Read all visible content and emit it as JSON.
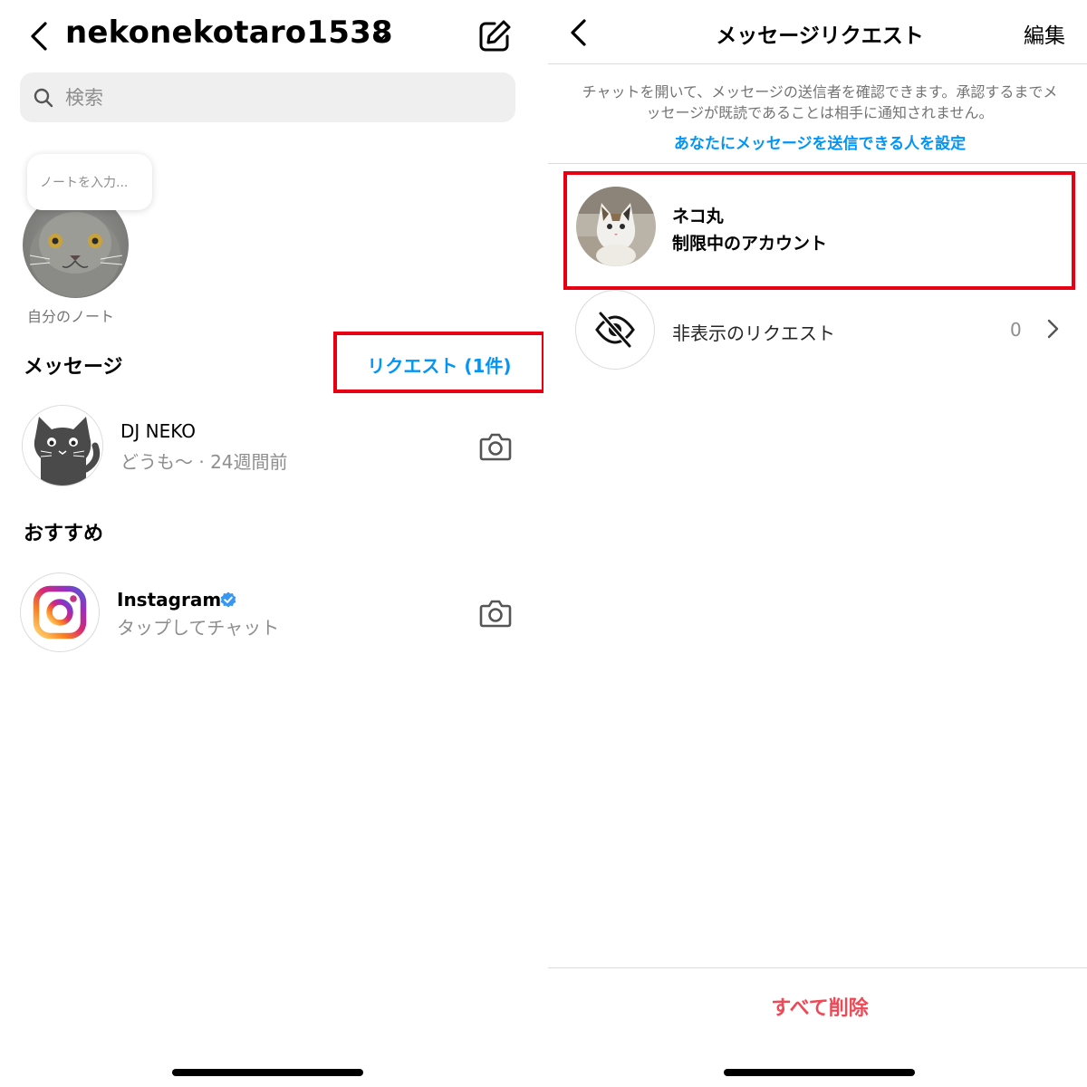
{
  "inbox": {
    "username": "nekonekotaro1538",
    "search": {
      "placeholder": "検索"
    },
    "note": {
      "placeholder": "ノートを入力...",
      "caption": "自分のノート"
    },
    "messages_heading": "メッセージ",
    "requests_link": "リクエスト (1件)",
    "threads": [
      {
        "name": "DJ NEKO",
        "preview": "どうも〜 · 24週間前"
      }
    ],
    "suggested_heading": "おすすめ",
    "suggested": [
      {
        "name": "Instagram",
        "preview": "タップしてチャット",
        "verified": true
      }
    ]
  },
  "requests_screen": {
    "title": "メッセージリクエスト",
    "edit_label": "編集",
    "info": "チャットを開いて、メッセージの送信者を確認できます。承認するまでメッセージが既読であることは相手に通知されません。",
    "settings_link": "あなたにメッセージを送信できる人を設定",
    "requests": [
      {
        "name": "ネコ丸",
        "status": "制限中のアカウント"
      }
    ],
    "hidden_requests": {
      "label": "非表示のリクエスト",
      "count": "0"
    },
    "delete_all_label": "すべて削除"
  },
  "colors": {
    "link_blue": "#0095f6",
    "highlight_red": "#e60012",
    "destructive_red": "#ed4956",
    "secondary_text": "#8e8e8e",
    "verified_blue": "#3897f0"
  },
  "icons": {
    "left": [
      "back-arrow-icon",
      "chevron-down-icon",
      "compose-icon",
      "search-icon",
      "camera-icon",
      "verified-badge-icon",
      "instagram-logo-icon"
    ],
    "right": [
      "back-arrow-icon",
      "eye-slash-icon",
      "chevron-right-icon"
    ]
  }
}
